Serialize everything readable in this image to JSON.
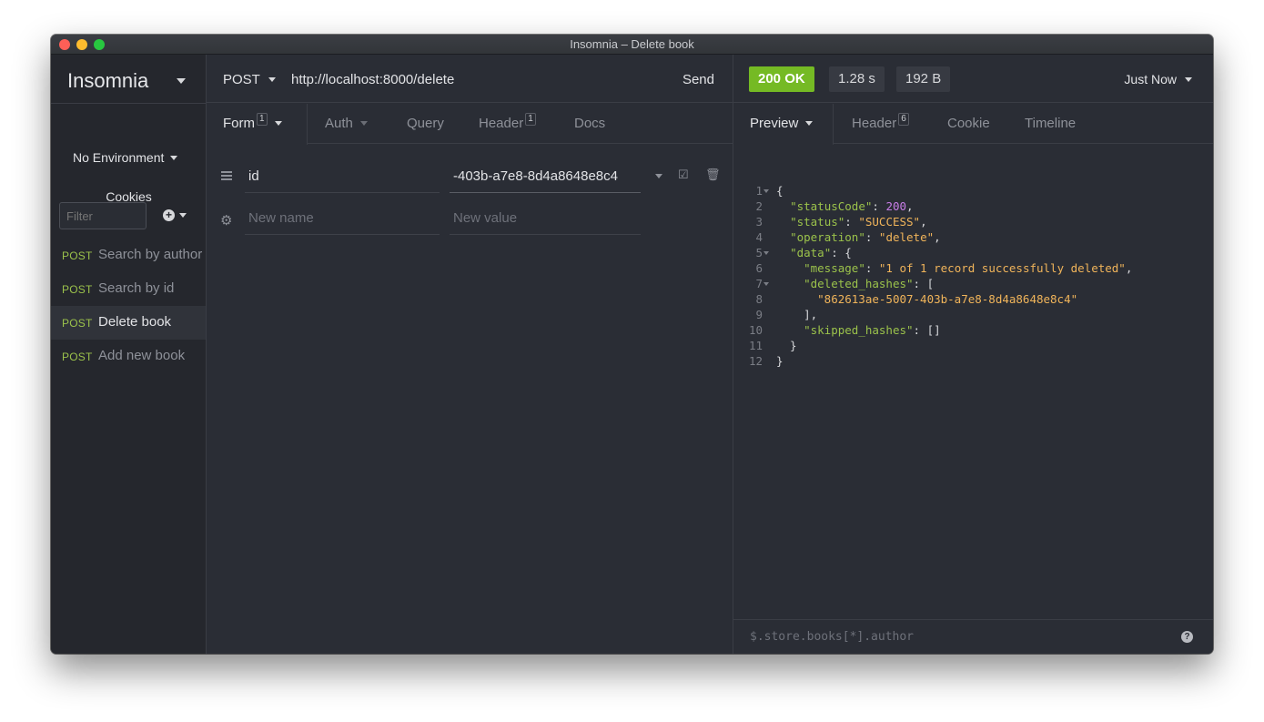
{
  "window": {
    "title": "Insomnia – Delete book"
  },
  "sidebar": {
    "brand": "Insomnia",
    "environment": "No Environment",
    "cookies_label": "Cookies",
    "filter_placeholder": "Filter",
    "requests": [
      {
        "method": "POST",
        "name": "Search by author",
        "active": false
      },
      {
        "method": "POST",
        "name": "Search by id",
        "active": false
      },
      {
        "method": "POST",
        "name": "Delete book",
        "active": true
      },
      {
        "method": "POST",
        "name": "Add new book",
        "active": false
      }
    ]
  },
  "request": {
    "method": "POST",
    "url": "http://localhost:8000/delete",
    "send_label": "Send",
    "tabs": [
      {
        "label": "Form",
        "badge": "1"
      },
      {
        "label": "Auth"
      },
      {
        "label": "Query"
      },
      {
        "label": "Header",
        "badge": "1"
      },
      {
        "label": "Docs"
      }
    ],
    "form_rows": [
      {
        "name": "id",
        "value": "-403b-a7e8-8d4a8648e8c4"
      }
    ],
    "new_row": {
      "name_placeholder": "New name",
      "value_placeholder": "New value"
    }
  },
  "response": {
    "status": "200 OK",
    "time": "1.28 s",
    "size": "192 B",
    "timestamp": "Just Now",
    "tabs": [
      {
        "label": "Preview"
      },
      {
        "label": "Header",
        "badge": "6"
      },
      {
        "label": "Cookie"
      },
      {
        "label": "Timeline"
      }
    ],
    "body_lines": [
      "1",
      "2",
      "3",
      "4",
      "5",
      "6",
      "7",
      "8",
      "9",
      "10",
      "11",
      "12"
    ],
    "body": {
      "statusCode_key": "\"statusCode\"",
      "statusCode_val": "200",
      "status_key": "\"status\"",
      "status_val": "\"SUCCESS\"",
      "operation_key": "\"operation\"",
      "operation_val": "\"delete\"",
      "data_key": "\"data\"",
      "message_key": "\"message\"",
      "message_val": "\"1 of 1 record successfully deleted\"",
      "deleted_key": "\"deleted_hashes\"",
      "deleted_val": "\"862613ae-5007-403b-a7e8-8d4a8648e8c4\"",
      "skipped_key": "\"skipped_hashes\"",
      "skipped_val": "[]"
    },
    "filter_placeholder": "$.store.books[*].author"
  },
  "colors": {
    "method": "#9bc24b",
    "ok": "#75ba24",
    "string": "#f0b45a",
    "number": "#c77de6"
  }
}
